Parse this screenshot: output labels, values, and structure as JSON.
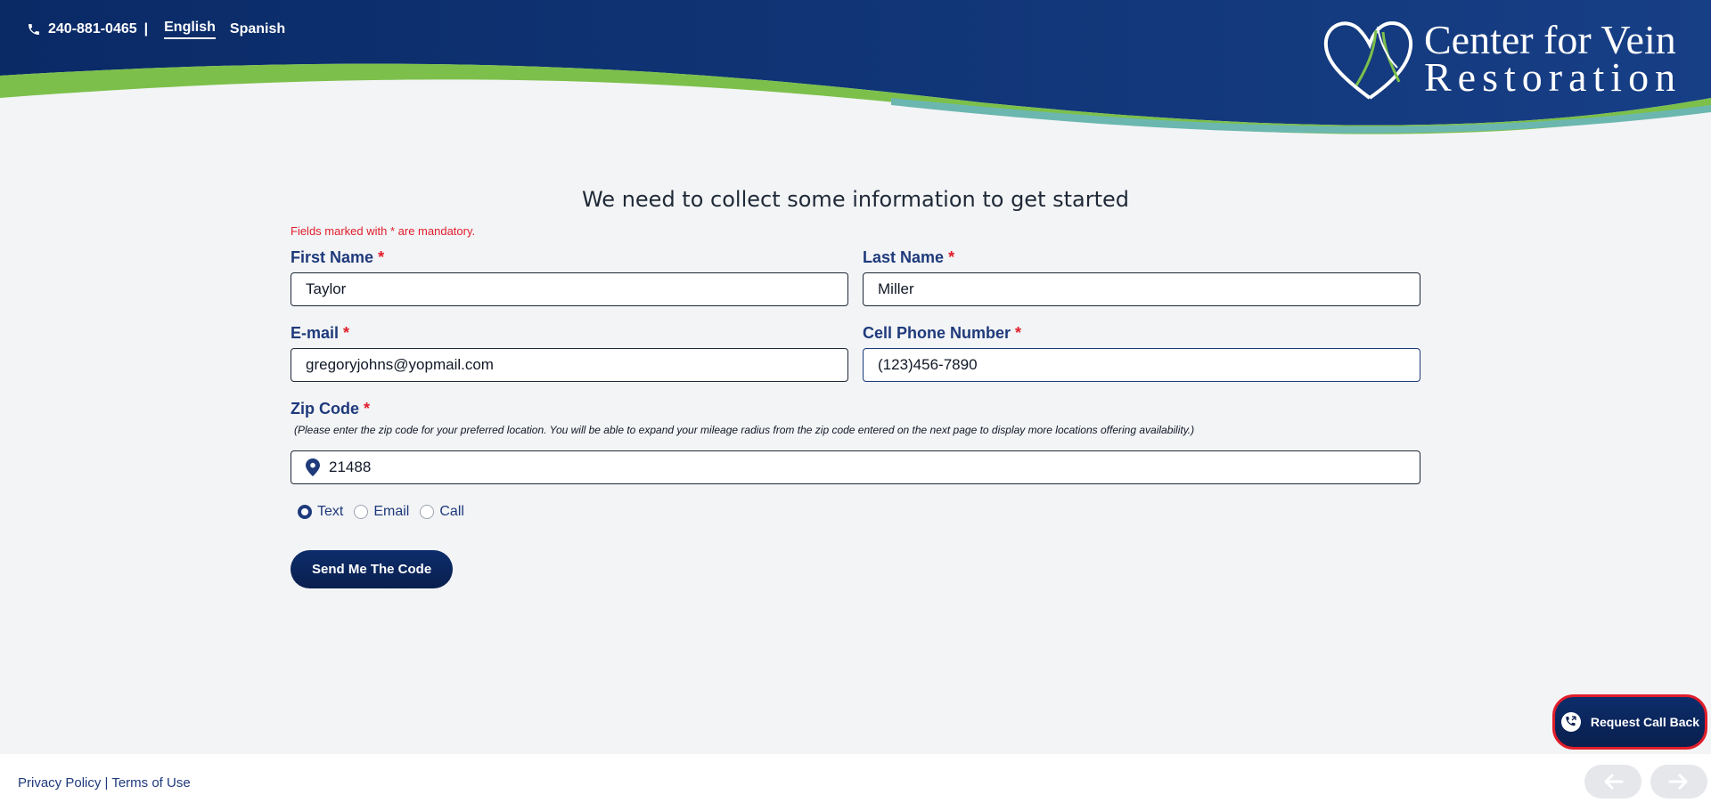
{
  "header": {
    "phone": "240-881-0465",
    "separator": "|",
    "languages": [
      {
        "label": "English",
        "active": true
      },
      {
        "label": "Spanish",
        "active": false
      }
    ],
    "logo": {
      "line1": "Center for Vein",
      "line2": "Restoration"
    },
    "colors": {
      "navy": "#0a2a66",
      "green": "#7cc04b"
    }
  },
  "form": {
    "heading": "We need to collect some information to get started",
    "mandatory_note": "Fields marked with * are mandatory.",
    "required_mark": "*",
    "first_name": {
      "label": "First Name",
      "value": "Taylor"
    },
    "last_name": {
      "label": "Last Name",
      "value": "Miller"
    },
    "email": {
      "label": "E-mail",
      "value": "gregoryjohns@yopmail.com"
    },
    "cell_phone": {
      "label": "Cell Phone Number",
      "value": "(123)456-7890"
    },
    "zip": {
      "label": "Zip Code",
      "hint": "(Please enter the zip code for your preferred location. You will be able to expand your mileage radius from the zip code entered on the next page to display more locations offering availability.)",
      "value": "21488"
    },
    "contact_options": [
      {
        "label": "Text",
        "checked": true
      },
      {
        "label": "Email",
        "checked": false
      },
      {
        "label": "Call",
        "checked": false
      }
    ],
    "submit_label": "Send Me The Code"
  },
  "callback": {
    "label": "Request Call Back",
    "accent": "#e11d2a"
  },
  "footer": {
    "privacy": "Privacy Policy",
    "separator": "|",
    "terms": "Terms of Use"
  }
}
